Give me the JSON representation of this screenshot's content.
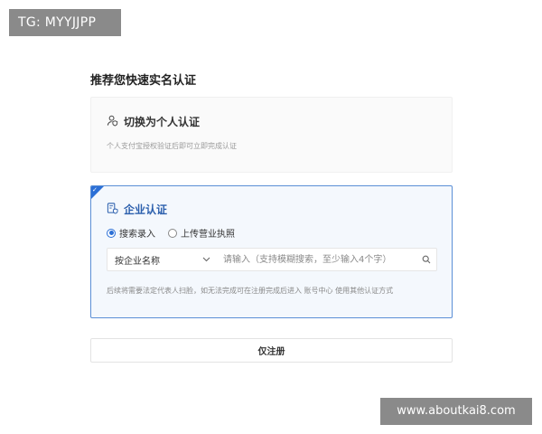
{
  "watermarks": {
    "top": "TG: MYYJJPP",
    "bottom": "www.aboutkai8.com"
  },
  "page": {
    "title": "推荐您快速实名认证"
  },
  "personal_card": {
    "icon": "person-shield-icon",
    "title": "切换为个人认证",
    "subtitle": "个人支付宝授权验证后即可立即完成认证"
  },
  "enterprise_card": {
    "icon": "document-shield-icon",
    "title": "企业认证",
    "selected": true,
    "radios": [
      {
        "label": "搜索录入",
        "checked": true
      },
      {
        "label": "上传营业执照",
        "checked": false
      }
    ],
    "search": {
      "select_value": "按企业名称",
      "placeholder": "请输入（支持模糊搜索，至少输入4个字）"
    },
    "hint": "后续将需要法定代表人扫脸，如无法完成可在注册完成后进入 账号中心 使用其他认证方式"
  },
  "register_button": {
    "label": "仅注册"
  },
  "colors": {
    "accent": "#2b6fd6",
    "selected_bg": "#f4f8fd",
    "muted_text": "#9a9a9a"
  }
}
